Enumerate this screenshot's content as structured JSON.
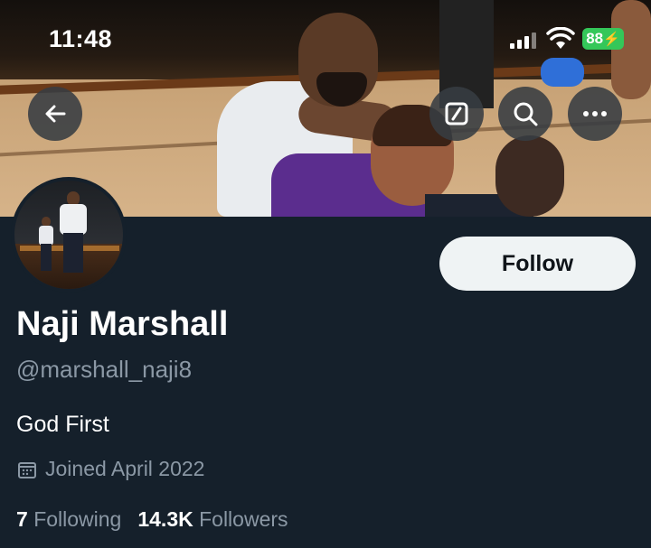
{
  "status_bar": {
    "time": "11:48",
    "battery": "88"
  },
  "icons": {
    "back": "arrow-left-icon",
    "compose": "edit-square-icon",
    "search": "search-icon",
    "more": "more-horizontal-icon",
    "calendar": "calendar-icon"
  },
  "profile": {
    "name": "Naji Marshall",
    "handle": "@marshall_naji8",
    "bio": "God First",
    "joined": "Joined April 2022",
    "following_count": "7",
    "following_label": "Following",
    "followers_count": "14.3K",
    "followers_label": "Followers"
  },
  "actions": {
    "follow_label": "Follow"
  },
  "colors": {
    "background": "#15202b",
    "secondary_text": "#8b98a5",
    "follow_button": "#eff3f4",
    "battery": "#34c759"
  }
}
